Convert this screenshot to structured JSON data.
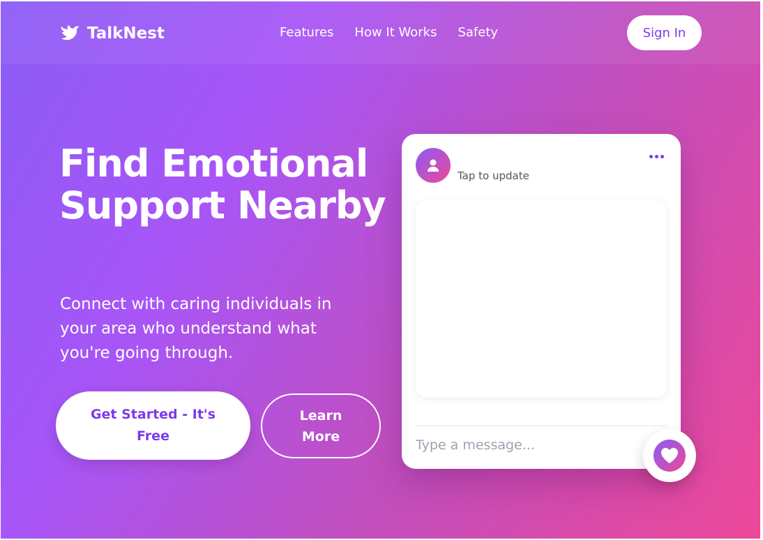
{
  "nav": {
    "brand": "TalkNest",
    "links": [
      {
        "label": "Features"
      },
      {
        "label": "How It Works"
      },
      {
        "label": "Safety"
      }
    ],
    "signin_label": "Sign In"
  },
  "hero": {
    "title": "Find Emotional Support Nearby",
    "subtitle": "Connect with caring individuals in your area who understand what you're going through.",
    "primary_cta": "Get Started - It's Free",
    "secondary_cta": "Learn More"
  },
  "chat_card": {
    "status": "Tap to update",
    "message_placeholder": "Type a message..."
  },
  "icons": {
    "brand_icon": "bird-icon",
    "avatar_icon": "user-icon",
    "menu_icon": "more-horizontal-icon",
    "heart_icon": "heart-icon"
  },
  "colors": {
    "gradient_start": "#8b5cf6",
    "gradient_end": "#ec4899",
    "accent": "#7c3aed"
  }
}
